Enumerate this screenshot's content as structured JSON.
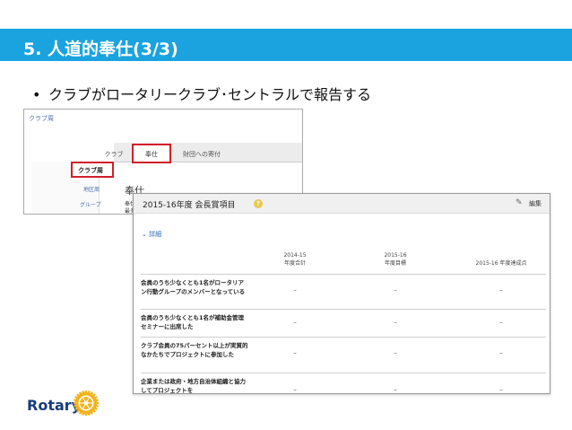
{
  "slide": {
    "title": "5. 人道的奉仕(3/3)",
    "bullet": "クラブがロータリークラブ･セントラルで報告する"
  },
  "background_screenshot": {
    "breadcrumb": "クラブ周",
    "tabs": [
      "クラブ",
      "奉仕",
      "財団への寄付"
    ],
    "nav": {
      "club": "クラブ周",
      "district": "地区周",
      "group": "グループ"
    },
    "section_title": "奉仕",
    "section_sub": "奉仕",
    "section_sub2": "最多"
  },
  "foreground_screenshot": {
    "title": "2015-16年度 会長賞項目",
    "help_icon": "?",
    "edit_label": "編集",
    "details_label": "詳細",
    "columns": [
      "2014-15\n年度合計",
      "2015-16\n年度目標",
      "2015-16 年度達成点"
    ],
    "rows": [
      {
        "label": "会員のうち少なくとも1名がロータリアン行動グループのメンバーとなっている",
        "values": [
          "–",
          "–",
          "–"
        ]
      },
      {
        "label": "会員のうち少なくとも1名が補助金管理セミナーに出席した",
        "values": [
          "–",
          "–",
          "–"
        ]
      },
      {
        "label": "クラブ会員の75パーセント以上が実質的なかたちでプロジェクトに参加した",
        "values": [
          "–",
          "–",
          "–"
        ]
      },
      {
        "label": "企業または政府・地方自治体組織と協力してプロジェクトを",
        "values": [
          "–",
          "–",
          "–"
        ]
      }
    ]
  },
  "logo": {
    "text": "Rotary"
  },
  "colors": {
    "header": "#1aa3df",
    "highlight": "#d0202a",
    "rotary_blue": "#173c7d",
    "rotary_gold": "#f2b31b"
  }
}
